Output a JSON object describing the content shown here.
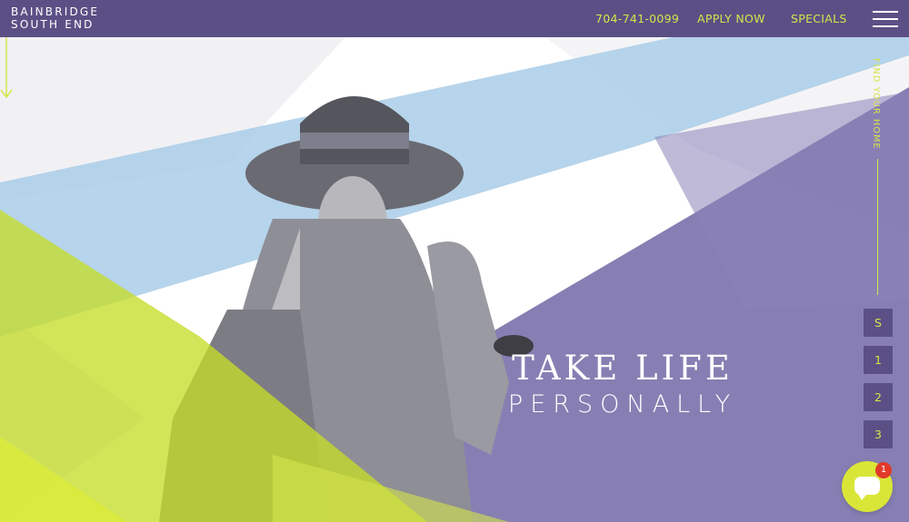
{
  "header": {
    "logo_line1": "BAINBRIDGE",
    "logo_line2": "SOUTH END",
    "phone": "704-741-0099",
    "apply_label": "APPLY NOW",
    "specials_label": "SPECIALS"
  },
  "hero": {
    "headline_line1": "TAKE LIFE",
    "headline_line2": "PERSONALLY"
  },
  "sidebar": {
    "find_home": "FIND YOUR HOME",
    "buttons": [
      "S",
      "1",
      "2",
      "3"
    ]
  },
  "chat": {
    "badge_count": "1"
  },
  "icons": {
    "menu": "hamburger-icon",
    "chat": "chat-bubble-icon",
    "scroll": "arrow-down-icon"
  },
  "colors": {
    "brand_purple": "#5b5085",
    "accent_lime": "#d4e54a",
    "sky_blue": "#a9cde8",
    "badge_red": "#e23a2a"
  }
}
